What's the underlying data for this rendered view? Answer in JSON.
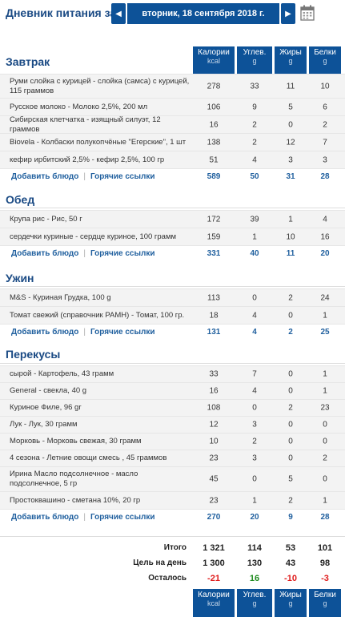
{
  "header": {
    "title": "Дневник питания за:",
    "prev": "◀",
    "date": "вторник, 18 сентября 2018 г.",
    "next": "▶"
  },
  "columns": [
    {
      "name": "Калории",
      "unit": "kcal"
    },
    {
      "name": "Углев.",
      "unit": "g"
    },
    {
      "name": "Жиры",
      "unit": "g"
    },
    {
      "name": "Белки",
      "unit": "g"
    }
  ],
  "links": {
    "add": "Добавить блюдо",
    "sep": "|",
    "quick": "Горячие ссылки"
  },
  "breakfast": {
    "title": "Завтрак",
    "items": [
      {
        "name": "Руми слойка с курицей - слойка (самса) с курицей, 115 граммов",
        "cal": "278",
        "carb": "33",
        "fat": "11",
        "prot": "10"
      },
      {
        "name": "Русское молоко - Молоко 2,5%, 200 мл",
        "cal": "106",
        "carb": "9",
        "fat": "5",
        "prot": "6"
      },
      {
        "name": "Сибирская клетчатка - изящный силуэт, 12 граммов",
        "cal": "16",
        "carb": "2",
        "fat": "0",
        "prot": "2"
      },
      {
        "name": "Biovela - Колбаски полукопчёные \"Егерские\", 1 шт",
        "cal": "138",
        "carb": "2",
        "fat": "12",
        "prot": "7"
      },
      {
        "name": "кефир ирбитский 2,5% - кефир 2,5%, 100 гр",
        "cal": "51",
        "carb": "4",
        "fat": "3",
        "prot": "3"
      }
    ],
    "total": {
      "cal": "589",
      "carb": "50",
      "fat": "31",
      "prot": "28"
    }
  },
  "lunch": {
    "title": "Обед",
    "items": [
      {
        "name": "Крупа рис - Рис, 50 г",
        "cal": "172",
        "carb": "39",
        "fat": "1",
        "prot": "4"
      },
      {
        "name": "сердечки куриные - сердце куриное, 100 грамм",
        "cal": "159",
        "carb": "1",
        "fat": "10",
        "prot": "16"
      }
    ],
    "total": {
      "cal": "331",
      "carb": "40",
      "fat": "11",
      "prot": "20"
    }
  },
  "dinner": {
    "title": "Ужин",
    "items": [
      {
        "name": "M&S - Куриная Грудка, 100 g",
        "cal": "113",
        "carb": "0",
        "fat": "2",
        "prot": "24"
      },
      {
        "name": "Томат свежий (справочник РАМН) - Томат, 100 гр.",
        "cal": "18",
        "carb": "4",
        "fat": "0",
        "prot": "1"
      }
    ],
    "total": {
      "cal": "131",
      "carb": "4",
      "fat": "2",
      "prot": "25"
    }
  },
  "snacks": {
    "title": "Перекусы",
    "items": [
      {
        "name": "сырой - Картофель, 43 грамм",
        "cal": "33",
        "carb": "7",
        "fat": "0",
        "prot": "1"
      },
      {
        "name": "General - свекла, 40 g",
        "cal": "16",
        "carb": "4",
        "fat": "0",
        "prot": "1"
      },
      {
        "name": "Куриное Филе, 96 gr",
        "cal": "108",
        "carb": "0",
        "fat": "2",
        "prot": "23"
      },
      {
        "name": "Лук - Лук, 30 грамм",
        "cal": "12",
        "carb": "3",
        "fat": "0",
        "prot": "0"
      },
      {
        "name": "Морковь - Морковь свежая, 30 грамм",
        "cal": "10",
        "carb": "2",
        "fat": "0",
        "prot": "0"
      },
      {
        "name": "4 сезона - Летние овощи смесь , 45 граммов",
        "cal": "23",
        "carb": "3",
        "fat": "0",
        "prot": "2"
      },
      {
        "name": "Ирина Масло подсолнечное - масло подсолнечное, 5 гр",
        "cal": "45",
        "carb": "0",
        "fat": "5",
        "prot": "0"
      },
      {
        "name": "Простоквашино - сметана 10%, 20 гр",
        "cal": "23",
        "carb": "1",
        "fat": "2",
        "prot": "1"
      }
    ],
    "total": {
      "cal": "270",
      "carb": "20",
      "fat": "9",
      "prot": "28"
    }
  },
  "summary": {
    "total": {
      "label": "Итого",
      "cal": "1 321",
      "carb": "114",
      "fat": "53",
      "prot": "101"
    },
    "goal": {
      "label": "Цель на день",
      "cal": "1 300",
      "carb": "130",
      "fat": "43",
      "prot": "98"
    },
    "left": {
      "label": "Осталось",
      "cal": "-21",
      "carb": "16",
      "fat": "-10",
      "prot": "-3"
    }
  },
  "colors": {
    "brand": "#0d5298",
    "link": "#1f5f9e",
    "negative": "#e01a1a",
    "positive": "#1e8b1e"
  }
}
